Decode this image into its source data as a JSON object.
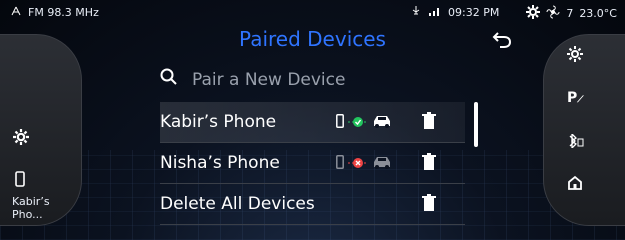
{
  "status": {
    "radio": "FM 98.3 MHz",
    "time": "09:32 PM",
    "fan_level": "7",
    "temperature": "23.0°C"
  },
  "header": {
    "title": "Paired Devices"
  },
  "search": {
    "placeholder": "Pair a New Device"
  },
  "devices": [
    {
      "name": "Kabir’s Phone",
      "connected": true
    },
    {
      "name": "Nisha’s Phone",
      "connected": false
    }
  ],
  "actions": {
    "delete_all": "Delete All Devices"
  },
  "left_panel": {
    "phone_label": "Kabir’s Pho..."
  },
  "colors": {
    "accent": "#2f74ff",
    "ok": "#22c55e",
    "err": "#ef4444"
  }
}
